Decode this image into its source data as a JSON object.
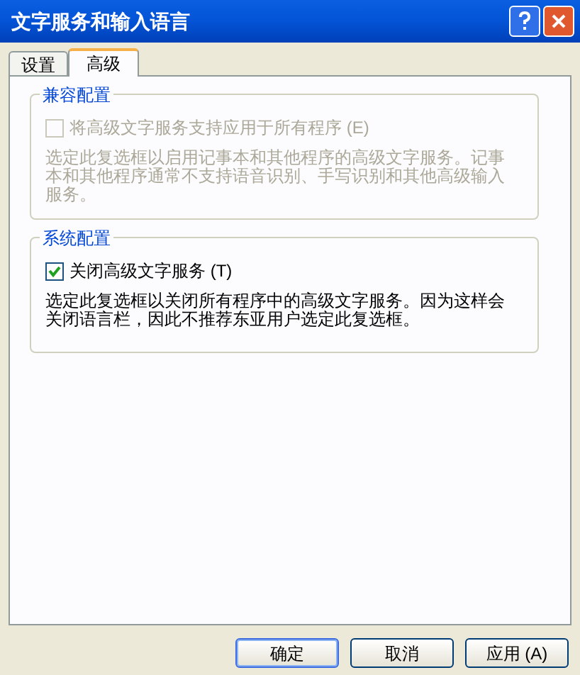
{
  "window": {
    "title": "文字服务和输入语言"
  },
  "tabs": [
    {
      "label": "设置",
      "selected": false
    },
    {
      "label": "高级",
      "selected": true
    }
  ],
  "groups": [
    {
      "title": "兼容配置",
      "checkbox": {
        "label": "将高级文字服务支持应用于所有程序 (E)",
        "checked": false,
        "disabled": true
      },
      "description": "选定此复选框以启用记事本和其他程序的高级文字服务。记事本和其他程序通常不支持语音识别、手写识别和其他高级输入服务。",
      "disabled": true
    },
    {
      "title": "系统配置",
      "checkbox": {
        "label": "关闭高级文字服务 (T)",
        "checked": true,
        "disabled": false
      },
      "description": "选定此复选框以关闭所有程序中的高级文字服务。因为这样会关闭语言栏，因此不推荐东亚用户选定此复选框。",
      "disabled": false
    }
  ],
  "buttons": [
    {
      "label": "确定",
      "default": true
    },
    {
      "label": "取消",
      "default": false
    },
    {
      "label": "应用 (A)",
      "default": false
    }
  ]
}
